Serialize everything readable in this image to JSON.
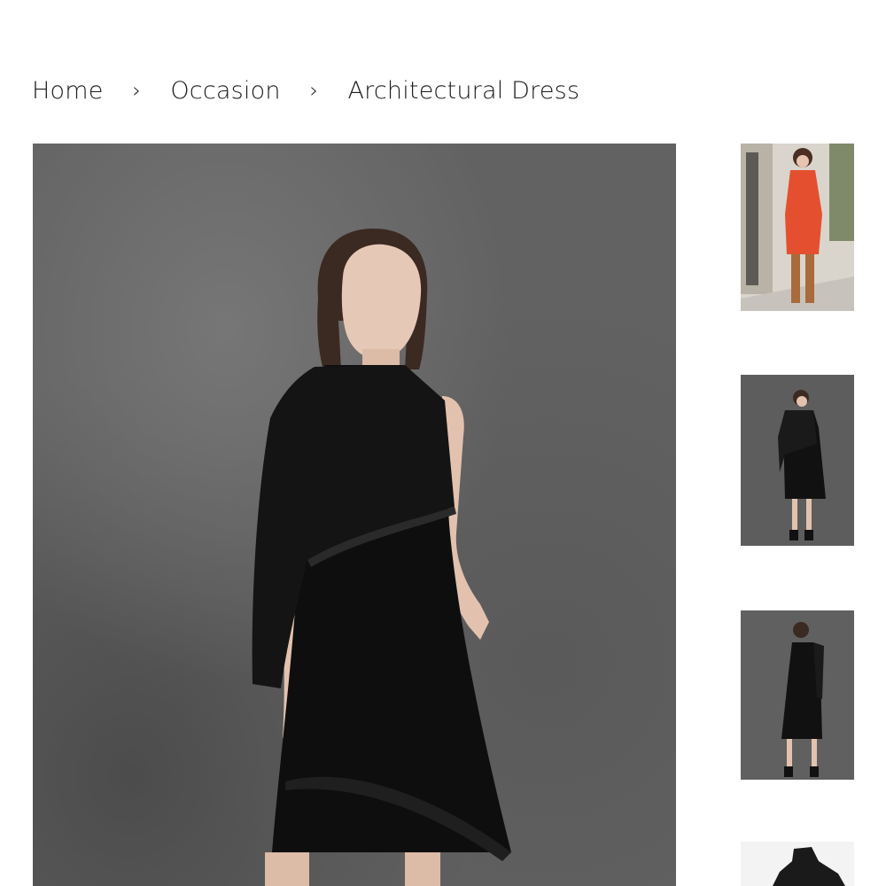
{
  "breadcrumb": {
    "items": [
      "Home",
      "Occasion"
    ],
    "separator": "›",
    "current": "Architectural Dress"
  },
  "product": {
    "main_image_alt": "Architectural Dress",
    "thumbnails": [
      {
        "alt": "Architectural Dress - red"
      },
      {
        "alt": "Architectural Dress - black front"
      },
      {
        "alt": "Architectural Dress - black back"
      },
      {
        "alt": "Architectural Dress - detail"
      }
    ]
  },
  "colors": {
    "text": "#1c1c1c",
    "backdrop": "#626262",
    "dress": "#0e0e0e",
    "red_dress": "#e4502f",
    "boots": "#a96a3c"
  }
}
